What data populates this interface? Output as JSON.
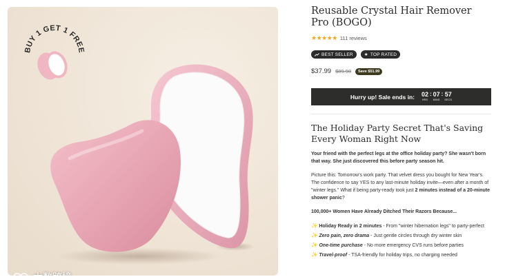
{
  "gallery": {
    "badge_text": "BUY 1 GET 1 FREE",
    "watermark": "大数跨境"
  },
  "product": {
    "title": "Reusable Crystal Hair Remover Pro (BOGO)",
    "rating": {
      "stars": "★★★★★",
      "reviews": "111 reviews"
    },
    "tags": [
      {
        "icon": "trend-icon",
        "label": "BEST SELLER"
      },
      {
        "icon": "star-icon",
        "label": "TOP RATED"
      }
    ],
    "price": "$37.99",
    "compare_price": "$89.98",
    "save_badge": "Save $51.99"
  },
  "timer": {
    "label": "Hurry up! Sale ends in:",
    "hours": "02",
    "minutes": "07",
    "seconds": "57",
    "hours_label": "HRS",
    "minutes_label": "MINS",
    "seconds_label": "SECS"
  },
  "description": {
    "headline": "The Holiday Party Secret That's Saving Every Woman Right Now",
    "intro": "Your friend with the perfect legs at the office holiday party? She wasn't born that way. She just discovered this before party season hit.",
    "para2_a": "Picture this: Tomorrow's work party. That velvet dress you bought for New Year's. The confidence to say YES to any last-minute holiday invite—even after a month of \"winter legs.\" What if being party-ready took just ",
    "para2_b": "2 minutes instead of a 20-minute shower panic",
    "para2_c": "?",
    "list_heading": "100,000+ Women Have Already Ditched Their Razors Because...",
    "benefits": [
      {
        "title": "Holiday Ready in 2 minutes",
        "text": " - From \"winter hibernation legs\" to party-perfect"
      },
      {
        "title": "Zero pain, zero drama",
        "text": " - Just gentle circles through dry winter skin"
      },
      {
        "title": "One-time purchase",
        "text": " - No more emergency CVS runs before parties"
      },
      {
        "title": "Travel-proof",
        "text": " - TSA-friendly for holiday trips, no charging needed"
      }
    ]
  },
  "colors": {
    "accent_dark": "#2d2d2b",
    "star": "#f2a81d",
    "product_pink": "#e8a9b6",
    "background": "#efe4d6"
  }
}
